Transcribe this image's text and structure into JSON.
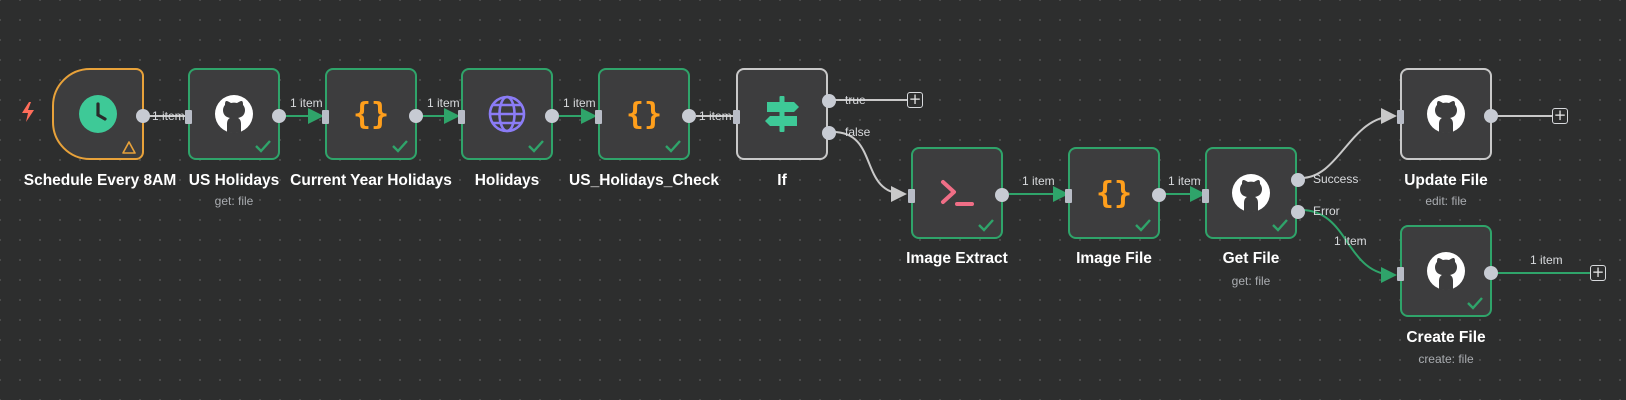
{
  "nodes": {
    "schedule": {
      "title": "Schedule Every 8AM",
      "icon": "clock-icon"
    },
    "us_holidays": {
      "title": "US Holidays",
      "subtitle": "get: file",
      "icon": "github-icon"
    },
    "current_year": {
      "title": "Current Year Holidays",
      "icon": "code-braces-icon"
    },
    "holidays": {
      "title": "Holidays",
      "icon": "globe-icon"
    },
    "us_check": {
      "title": "US_Holidays_Check",
      "icon": "code-braces-icon"
    },
    "if": {
      "title": "If",
      "icon": "signpost-icon"
    },
    "image_extract": {
      "title": "Image Extract",
      "icon": "terminal-icon"
    },
    "image_file": {
      "title": "Image File",
      "icon": "code-braces-icon"
    },
    "get_file": {
      "title": "Get File",
      "subtitle": "get: file",
      "icon": "github-icon"
    },
    "update_file": {
      "title": "Update File",
      "subtitle": "edit: file",
      "icon": "github-icon"
    },
    "create_file": {
      "title": "Create File",
      "subtitle": "create: file",
      "icon": "github-icon"
    }
  },
  "edges": {
    "e1": "1 item",
    "e2": "1 item",
    "e3": "1 item",
    "e4": "1 item",
    "e5": "1 item",
    "e6": "1 item",
    "e7": "1 item",
    "e8": "1 item",
    "e9": "1 item"
  },
  "branches": {
    "true": "true",
    "false": "false",
    "success": "Success",
    "error": "Error"
  },
  "plus_symbol": "+",
  "colors": {
    "canvas": "#2d2e2e",
    "success_border": "#2fa46a",
    "trigger_border": "#e8a23a",
    "edge_active": "#2fa46a",
    "edge_idle": "#c9c9c9",
    "trigger_bolt": "#ff6d5a"
  }
}
